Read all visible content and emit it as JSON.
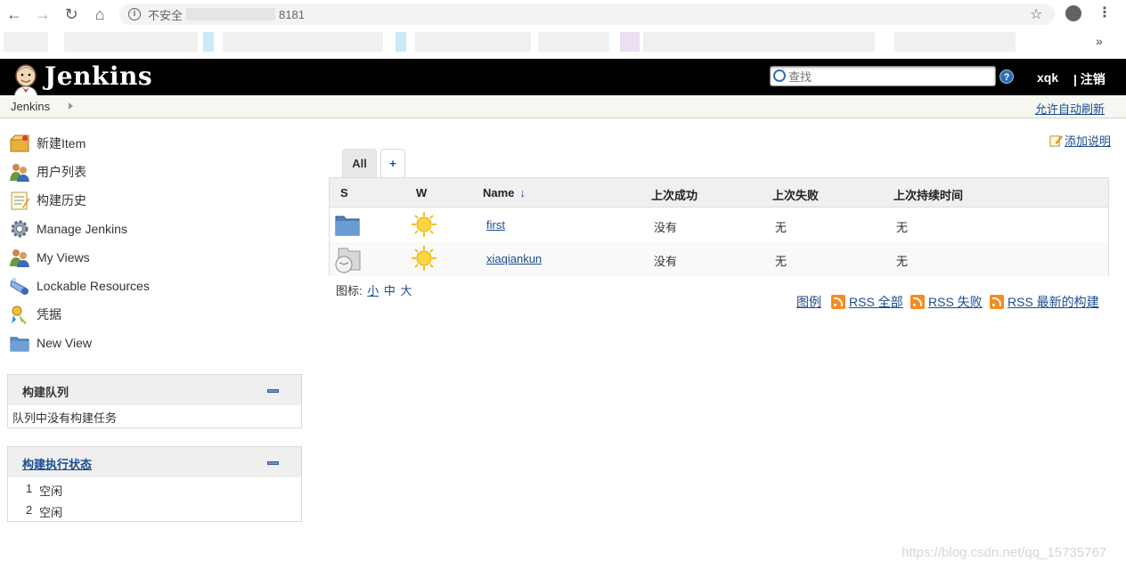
{
  "browser": {
    "security_label": "不安全",
    "port": "8181"
  },
  "header": {
    "logo_text": "Jenkins",
    "search_placeholder": "查找",
    "user": "xqk",
    "logout": "| 注销",
    "help": "?"
  },
  "breadcrumb": {
    "root": "Jenkins",
    "auto_refresh": "允许自动刷新"
  },
  "tasks": [
    {
      "label": "新建Item",
      "icon": "new-item-icon"
    },
    {
      "label": "用户列表",
      "icon": "people-icon"
    },
    {
      "label": "构建历史",
      "icon": "notepad-icon"
    },
    {
      "label": "Manage Jenkins",
      "icon": "gear-icon"
    },
    {
      "label": "My Views",
      "icon": "people-icon"
    },
    {
      "label": "Lockable Resources",
      "icon": "lock-resources-icon"
    },
    {
      "label": "凭据",
      "icon": "credentials-icon"
    },
    {
      "label": "New View",
      "icon": "folder-icon"
    }
  ],
  "build_queue": {
    "title": "构建队列",
    "empty_text": "队列中没有构建任务"
  },
  "executors": {
    "title": "构建执行状态",
    "items": [
      {
        "num": "1",
        "status": "空闲"
      },
      {
        "num": "2",
        "status": "空闲"
      }
    ]
  },
  "main": {
    "add_description": "添加说明",
    "tab_all": "All",
    "tab_add": "+",
    "columns": {
      "s": "S",
      "w": "W",
      "name": "Name",
      "sort": "↓",
      "last_success": "上次成功",
      "last_failure": "上次失败",
      "last_duration": "上次持续时间"
    },
    "jobs": [
      {
        "name": "first",
        "last_success": "没有",
        "last_failure": "无",
        "last_duration": "无",
        "status_icon": "folder-icon",
        "weather_icon": "sunny-icon"
      },
      {
        "name": "xiaqiankun",
        "last_success": "没有",
        "last_failure": "无",
        "last_duration": "无",
        "status_icon": "disabled-project-icon",
        "weather_icon": "sunny-icon"
      }
    ],
    "icon_label": "图标:",
    "icon_sizes": {
      "small": "小",
      "medium": "中",
      "large": "大"
    },
    "legend": "图例",
    "rss_all": "RSS 全部",
    "rss_failed": "RSS 失败",
    "rss_latest": "RSS 最新的构建"
  },
  "watermark": "https://blog.csdn.net/qq_15735767"
}
